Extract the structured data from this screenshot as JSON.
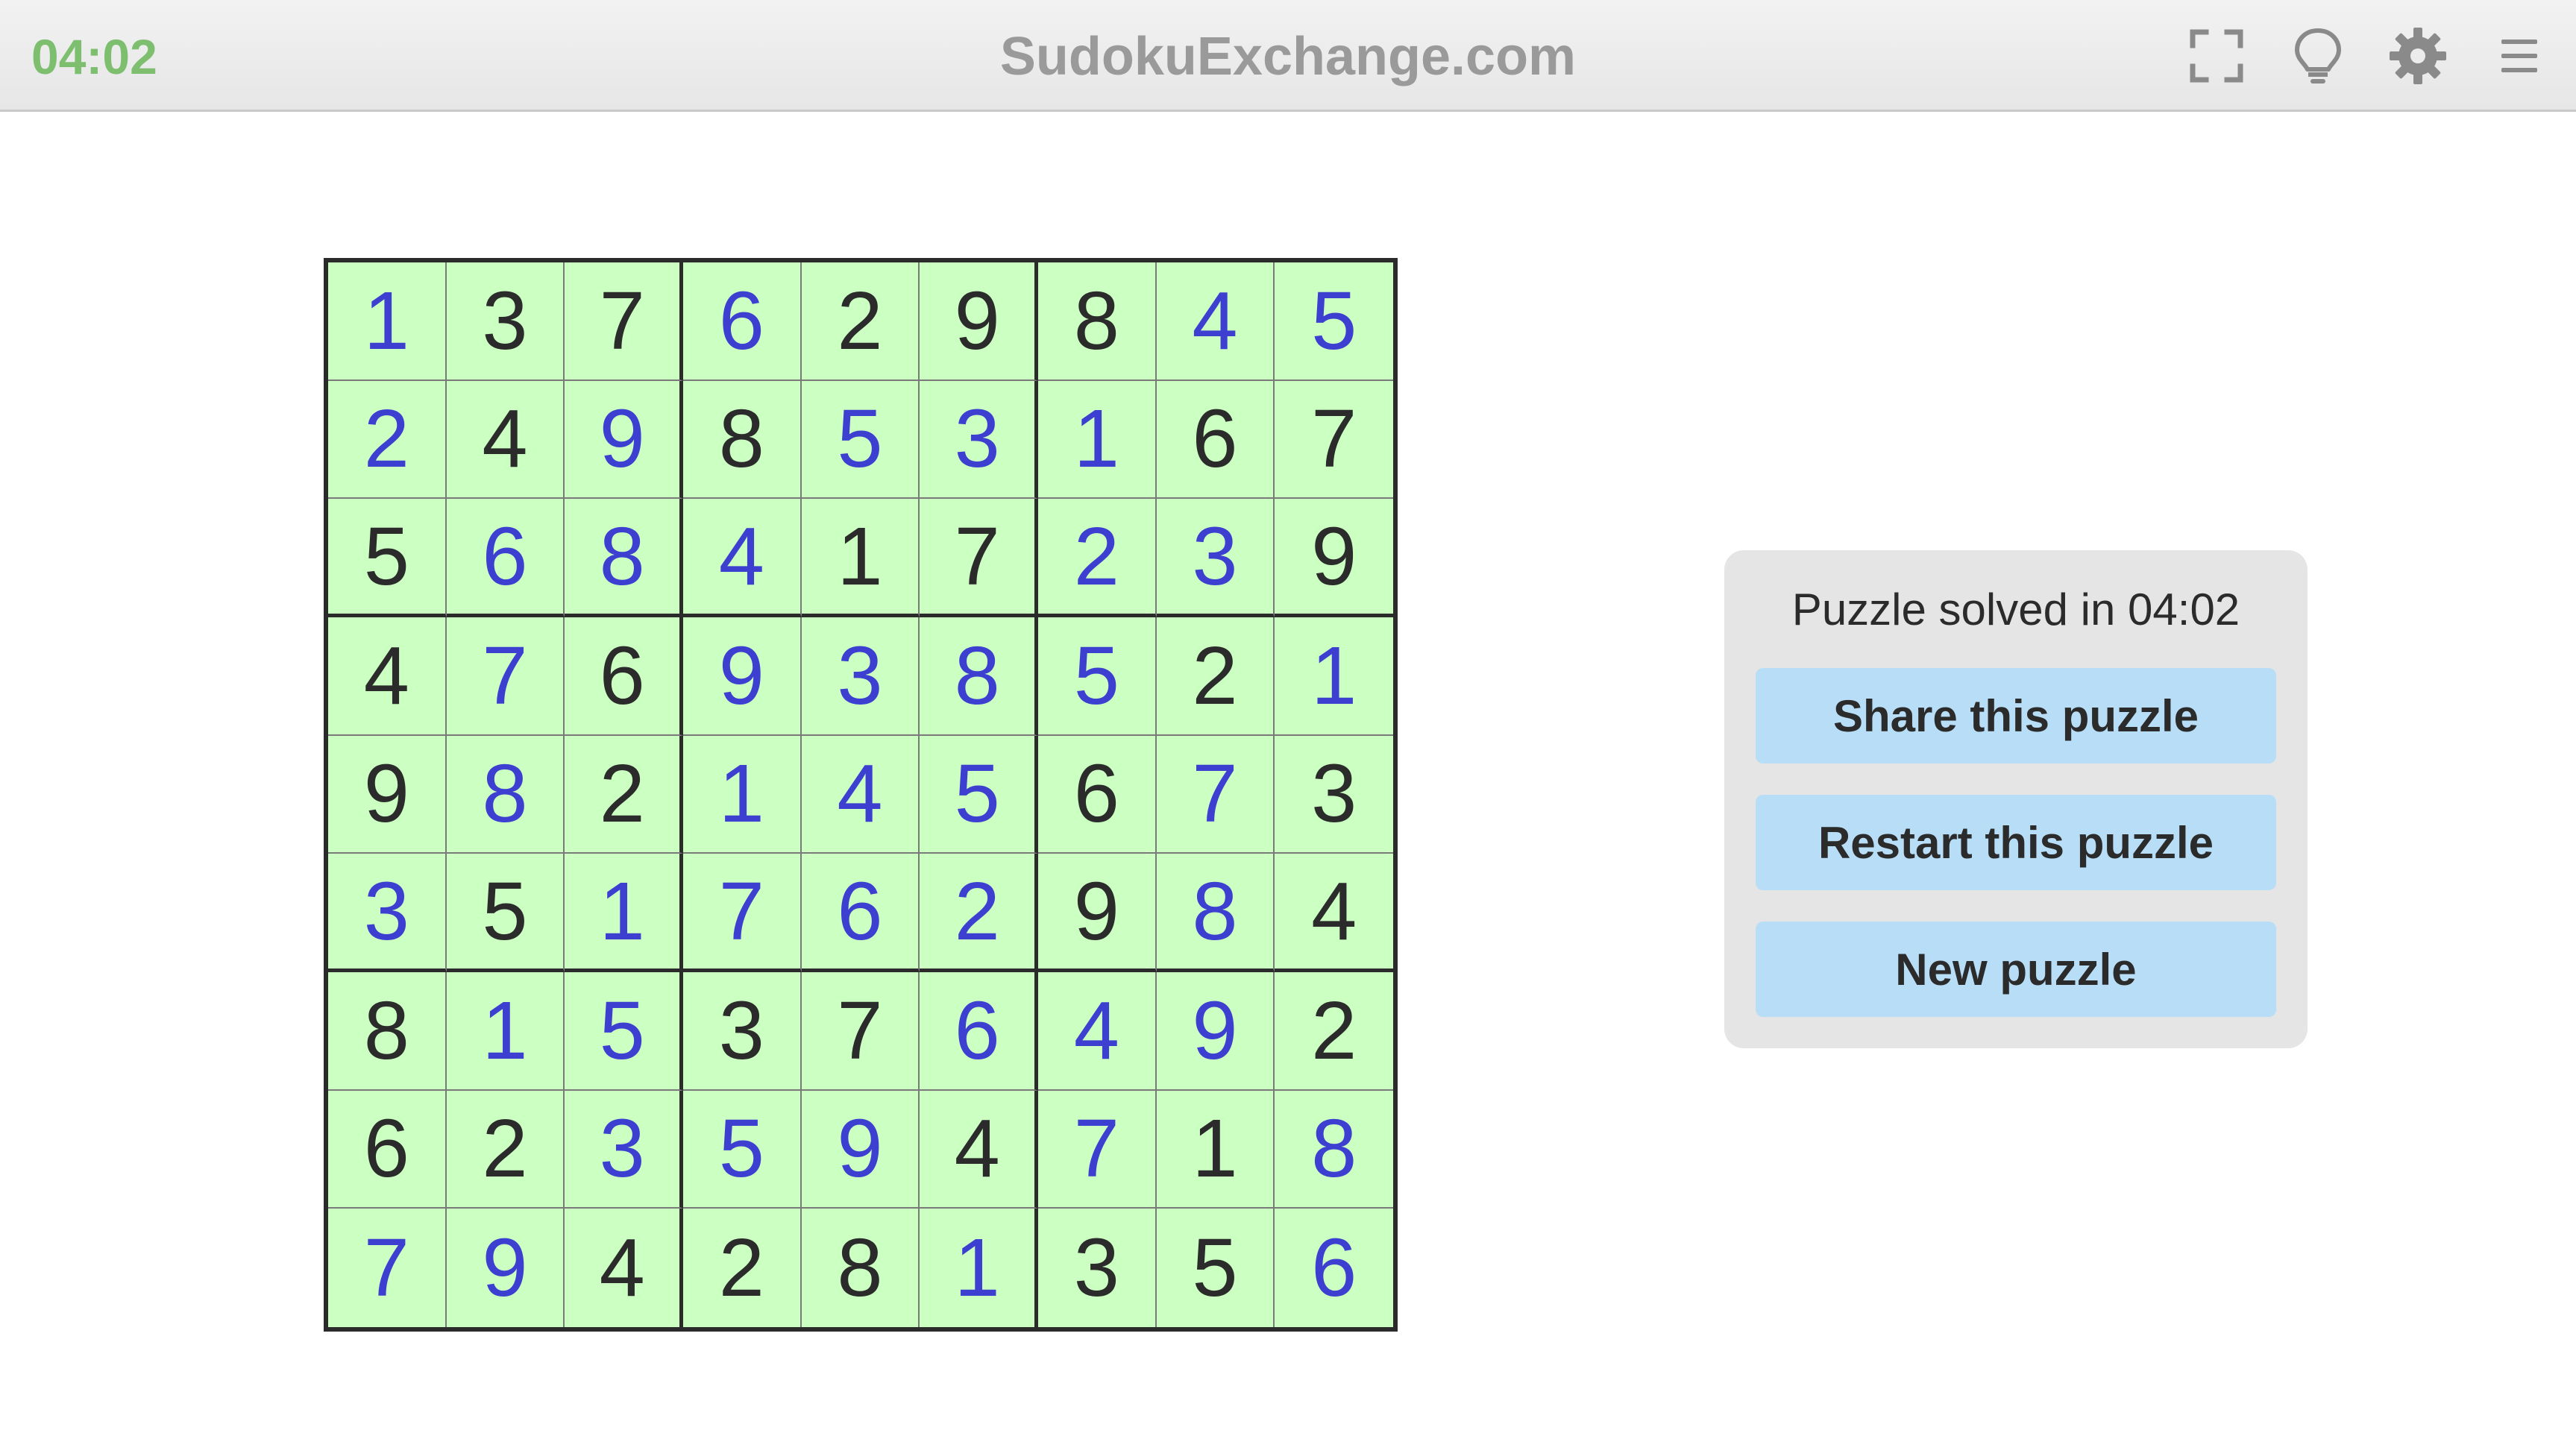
{
  "header": {
    "timer": "04:02",
    "brand": "SudokuExchange.com",
    "icons": [
      "fullscreen-icon",
      "lightbulb-icon",
      "gear-icon",
      "menu-icon"
    ]
  },
  "colors": {
    "grid_background": "#ccffc2",
    "given_digit": "#2b2b2b",
    "entered_digit": "#3c3fd0",
    "timer": "#7dbf6f",
    "button": "#b7ddf7"
  },
  "board": {
    "rows": [
      [
        1,
        3,
        7,
        6,
        2,
        9,
        8,
        4,
        5
      ],
      [
        2,
        4,
        9,
        8,
        5,
        3,
        1,
        6,
        7
      ],
      [
        5,
        6,
        8,
        4,
        1,
        7,
        2,
        3,
        9
      ],
      [
        4,
        7,
        6,
        9,
        3,
        8,
        5,
        2,
        1
      ],
      [
        9,
        8,
        2,
        1,
        4,
        5,
        6,
        7,
        3
      ],
      [
        3,
        5,
        1,
        7,
        6,
        2,
        9,
        8,
        4
      ],
      [
        8,
        1,
        5,
        3,
        7,
        6,
        4,
        9,
        2
      ],
      [
        6,
        2,
        3,
        5,
        9,
        4,
        7,
        1,
        8
      ],
      [
        7,
        9,
        4,
        2,
        8,
        1,
        3,
        5,
        6
      ]
    ],
    "entered": [
      [
        1,
        0,
        0,
        1,
        0,
        0,
        0,
        1,
        1
      ],
      [
        1,
        0,
        1,
        0,
        1,
        1,
        1,
        0,
        0
      ],
      [
        0,
        1,
        1,
        1,
        0,
        0,
        1,
        1,
        0
      ],
      [
        0,
        1,
        0,
        1,
        1,
        1,
        1,
        0,
        1
      ],
      [
        0,
        1,
        0,
        1,
        1,
        1,
        0,
        1,
        0
      ],
      [
        1,
        0,
        1,
        1,
        1,
        1,
        0,
        1,
        0
      ],
      [
        0,
        1,
        1,
        0,
        0,
        1,
        1,
        1,
        0
      ],
      [
        0,
        0,
        1,
        1,
        1,
        0,
        1,
        0,
        1
      ],
      [
        1,
        1,
        0,
        0,
        0,
        1,
        0,
        0,
        1
      ]
    ]
  },
  "panel": {
    "message": "Puzzle solved in 04:02",
    "share_label": "Share this puzzle",
    "restart_label": "Restart this puzzle",
    "new_label": "New puzzle"
  }
}
